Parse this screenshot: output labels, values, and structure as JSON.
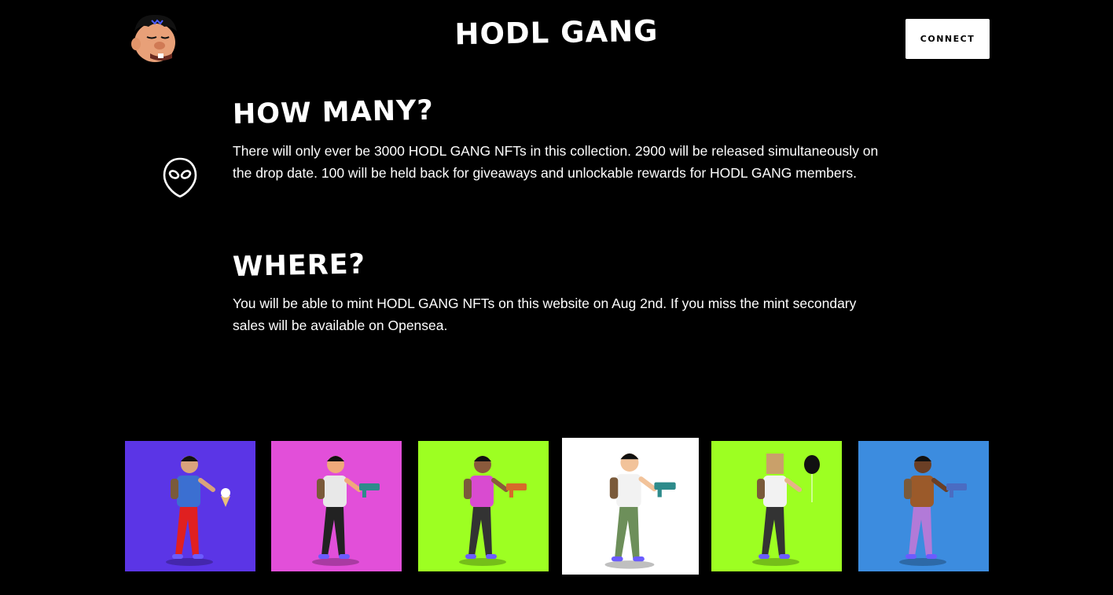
{
  "header": {
    "brand": "HODL GANG",
    "connect_label": "CONNECT"
  },
  "icons": {
    "logo": "gang-member-face-icon",
    "section": "alien-head-icon"
  },
  "sections": [
    {
      "heading": "HOW MANY?",
      "body": "There will only ever be 3000 HODL GANG NFTs in this collection. 2900 will be released simultaneously on the drop date. 100 will be held back for giveaways and unlockable rewards for HODL GANG members."
    },
    {
      "heading": "WHERE?",
      "body": "You will be able to mint HODL GANG NFTs on this website on Aug 2nd. If you miss the mint secondary sales will be available on Opensea."
    }
  ],
  "gallery": [
    {
      "bg": "#5b35e6",
      "item": "ice-cream"
    },
    {
      "bg": "#e24fd9",
      "item": "blaster"
    },
    {
      "bg": "#9dff22",
      "item": "ray-gun"
    },
    {
      "bg": "#ffffff",
      "item": "blaster",
      "selected": true
    },
    {
      "bg": "#9dff22",
      "item": "balloon"
    },
    {
      "bg": "#3c8cdf",
      "item": "pistol"
    }
  ],
  "colors": {
    "background": "#000000",
    "text": "#ffffff",
    "button_bg": "#ffffff",
    "button_text": "#000000"
  }
}
